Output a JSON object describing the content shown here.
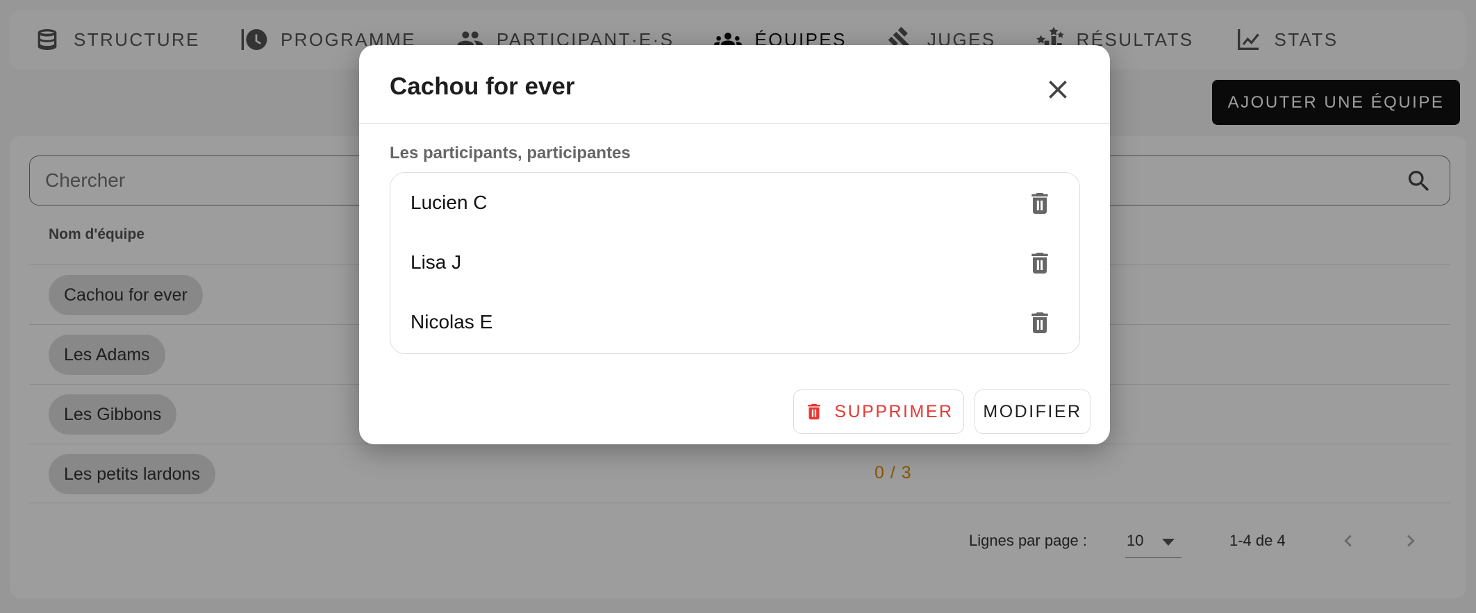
{
  "nav": {
    "items": [
      {
        "label": "STRUCTURE",
        "icon": "database-icon"
      },
      {
        "label": "PROGRAMME",
        "icon": "schedule-history-icon"
      },
      {
        "label": "PARTICIPANT·E·S",
        "icon": "people-icon"
      },
      {
        "label": "ÉQUIPES",
        "icon": "groups-icon",
        "active": true
      },
      {
        "label": "JUGES",
        "icon": "gavel-icon"
      },
      {
        "label": "RÉSULTATS",
        "icon": "stars-icon"
      },
      {
        "label": "STATS",
        "icon": "line-chart-icon"
      }
    ]
  },
  "actions": {
    "add_team_label": "AJOUTER UNE ÉQUIPE"
  },
  "search": {
    "placeholder": "Chercher"
  },
  "table": {
    "column_team_name": "Nom d'équipe",
    "rows": [
      {
        "name": "Cachou for ever",
        "count": ""
      },
      {
        "name": "Les Adams",
        "count": ""
      },
      {
        "name": "Les Gibbons",
        "count": ""
      },
      {
        "name": "Les petits lardons",
        "count": "0 / 3"
      }
    ]
  },
  "pagination": {
    "rows_per_page_label": "Lignes par page :",
    "rows_per_page_value": "10",
    "range": "1-4 de 4"
  },
  "modal": {
    "title": "Cachou for ever",
    "section_label": "Les participants, participantes",
    "participants": [
      "Lucien C",
      "Lisa J",
      "Nicolas E"
    ],
    "delete_label": "SUPPRIMER",
    "edit_label": "MODIFIER"
  },
  "colors": {
    "danger": "#e53935",
    "warning": "#e08a00",
    "primary": "#111111"
  }
}
